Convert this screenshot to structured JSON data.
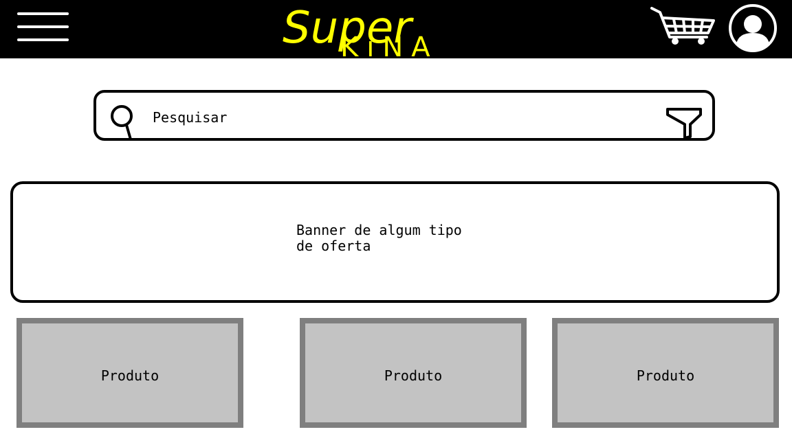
{
  "header": {
    "logo_line1": "Super",
    "logo_line2": "KiNA",
    "logo_color": "#ffff00",
    "background": "#000000",
    "menu_icon": "hamburger-icon",
    "cart_icon": "cart-icon",
    "profile_icon": "user-avatar-icon"
  },
  "search": {
    "placeholder": "Pesquisar",
    "value": "",
    "search_icon": "magnifier-icon",
    "filter_icon": "filter-funnel-icon"
  },
  "banner": {
    "text": "Banner de algum tipo\nde oferta"
  },
  "products": [
    {
      "label": "Produto"
    },
    {
      "label": "Produto"
    },
    {
      "label": "Produto"
    }
  ],
  "colors": {
    "product_fill": "#c3c3c3",
    "product_border": "#7f7f7f"
  }
}
